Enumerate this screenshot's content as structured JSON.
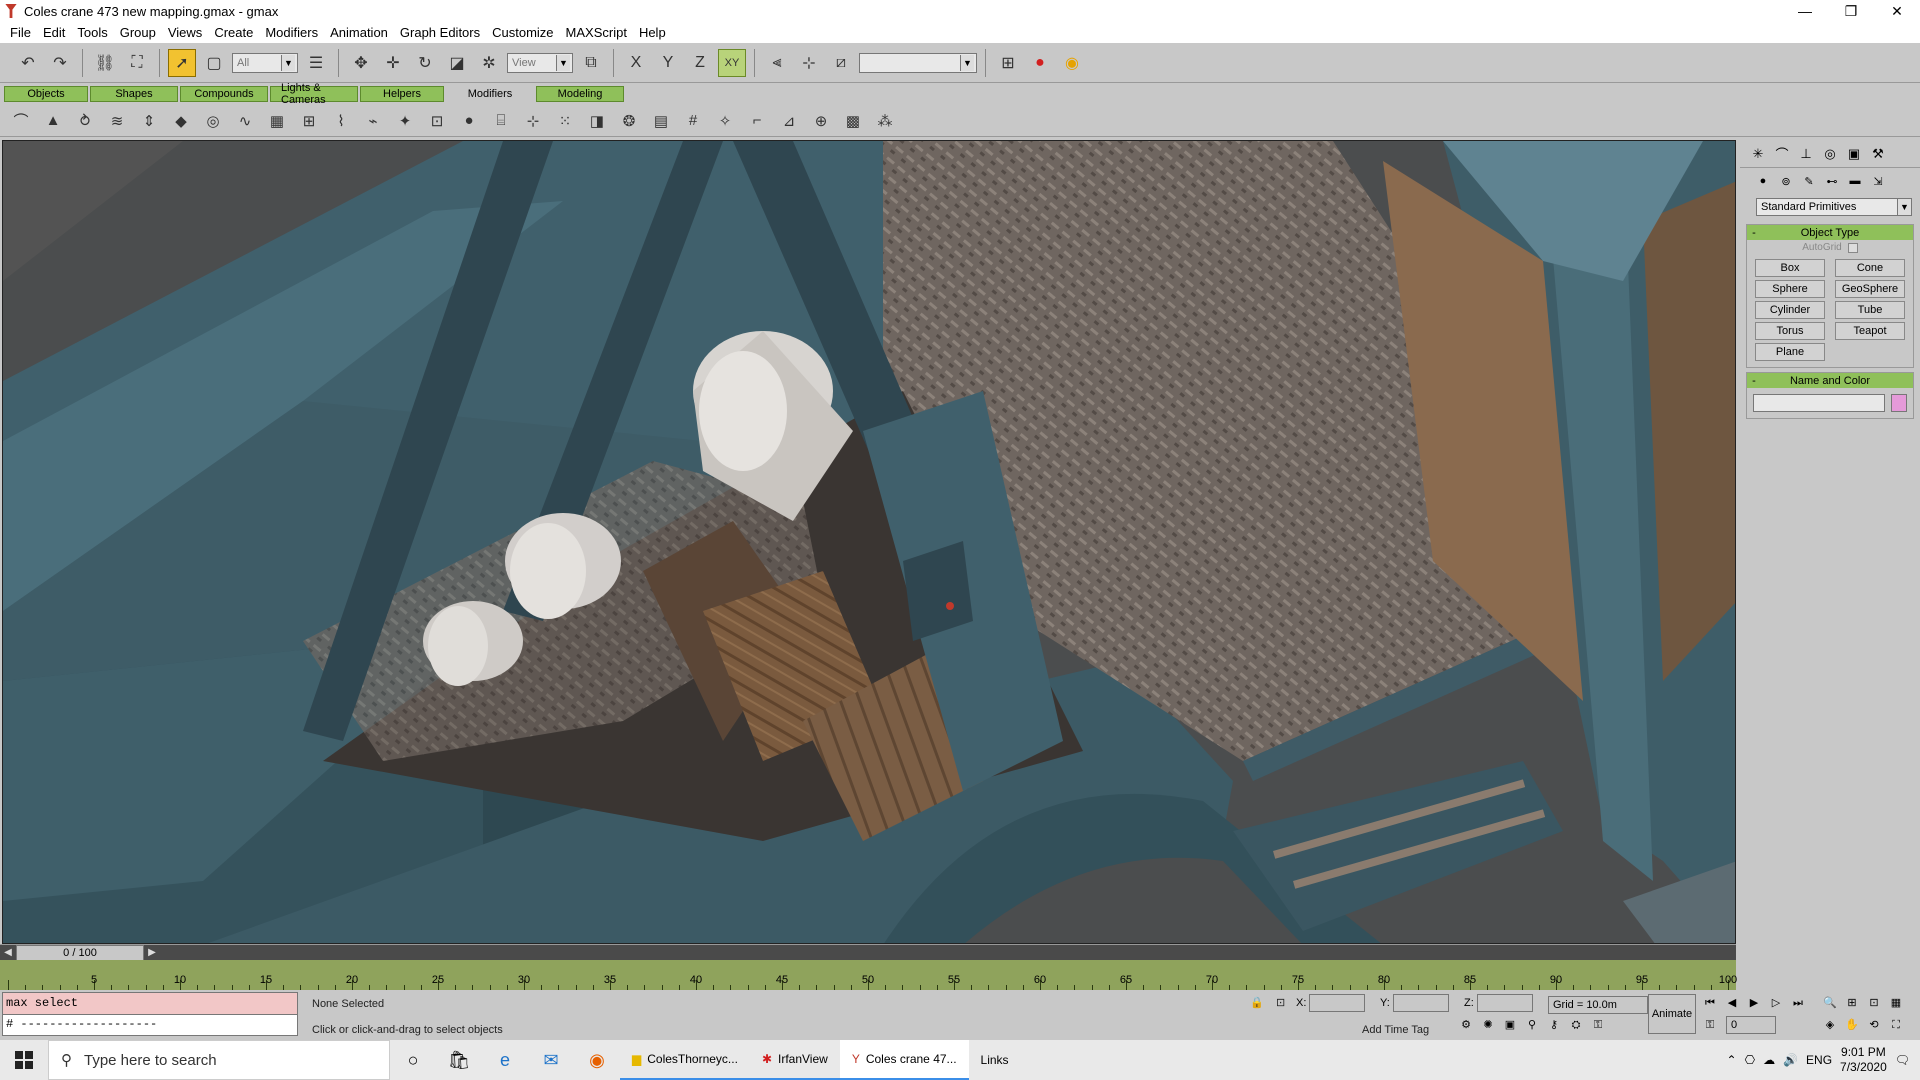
{
  "window": {
    "title": "Coles crane 473 new mapping.gmax - gmax",
    "controls": [
      "—",
      "❐",
      "✕"
    ]
  },
  "menu": [
    "File",
    "Edit",
    "Tools",
    "Group",
    "Views",
    "Create",
    "Modifiers",
    "Animation",
    "Graph Editors",
    "Customize",
    "MAXScript",
    "Help"
  ],
  "toolbar": {
    "selection_filter": "All",
    "ref_coord": "View"
  },
  "tabs": [
    "Objects",
    "Shapes",
    "Compounds",
    "Lights & Cameras",
    "Helpers",
    "Modifiers",
    "Modeling"
  ],
  "selected_tab": "Modifiers",
  "command_panel": {
    "dropdown": "Standard Primitives",
    "object_type": {
      "title": "Object Type",
      "autogrid": "AutoGrid",
      "buttons": [
        "Box",
        "Cone",
        "Sphere",
        "GeoSphere",
        "Cylinder",
        "Tube",
        "Torus",
        "Teapot",
        "Plane"
      ]
    },
    "name_color": {
      "title": "Name and Color",
      "color": "#e59ad9"
    }
  },
  "timeline": {
    "frame": "0 / 100",
    "ticks": [
      "5",
      "10",
      "15",
      "20",
      "25",
      "30",
      "35",
      "40",
      "45",
      "50",
      "55",
      "60",
      "65",
      "70",
      "75",
      "80",
      "85",
      "90",
      "95",
      "100"
    ]
  },
  "status": {
    "maxscript_line1": "max select",
    "maxscript_line2": "# -------------------",
    "selection": "None Selected",
    "prompt": "Click or click-and-drag to select objects",
    "x_label": "X:",
    "y_label": "Y:",
    "z_label": "Z:",
    "grid": "Grid = 10.0m",
    "add_time_tag": "Add Time Tag",
    "animate": "Animate",
    "frame_value": "0"
  },
  "taskbar": {
    "search_placeholder": "Type here to search",
    "apps": [
      {
        "label": "ColesThorneyc...",
        "icon": "folder-icon"
      },
      {
        "label": "IrfanView",
        "icon": "irfanview-icon"
      },
      {
        "label": "Coles crane 47...",
        "icon": "gmax-icon"
      }
    ],
    "links": "Links",
    "lang": "ENG",
    "time": "9:01 PM",
    "date": "7/3/2020"
  }
}
